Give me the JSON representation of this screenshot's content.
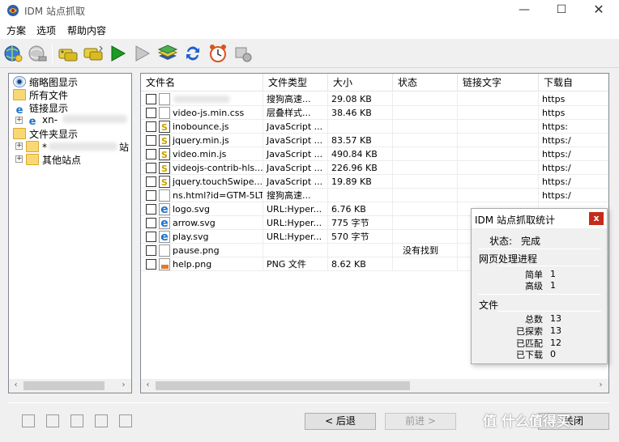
{
  "window": {
    "title": "IDM 站点抓取",
    "min_glyph": "—",
    "max_glyph": "☐",
    "close_glyph": "✕"
  },
  "menu": [
    "方案",
    "选项",
    "帮助内容"
  ],
  "toolbar": [
    "globe-connect-icon",
    "globe-disconnect-icon",
    "download-files-icon",
    "download-all-icon",
    "start-play-icon",
    "stop-play-icon",
    "queue-stack-icon",
    "refresh-icon",
    "scheduler-clock-icon",
    "settings-icon"
  ],
  "tree": {
    "items": [
      {
        "label": "缩略图显示"
      },
      {
        "label": "所有文件"
      },
      {
        "label": "链接显示"
      },
      {
        "label": "xn-"
      },
      {
        "label": "文件夹显示"
      },
      {
        "label": "*"
      },
      {
        "label": "站"
      },
      {
        "label": "其他站点"
      }
    ],
    "expander_plus": "+"
  },
  "list": {
    "columns": [
      "文件名",
      "文件类型",
      "大小",
      "状态",
      "链接文字",
      "下载自"
    ],
    "rows": [
      {
        "name": "",
        "type": "搜狗高速...",
        "size": "29.08 KB",
        "status": "",
        "link": "",
        "from": "https",
        "icon": "doc"
      },
      {
        "name": "video-js.min.css",
        "type": "层叠样式...",
        "size": "38.46 KB",
        "status": "",
        "link": "",
        "from": "https",
        "icon": "css"
      },
      {
        "name": "inobounce.js",
        "type": "JavaScript ...",
        "size": "",
        "status": "",
        "link": "",
        "from": "https:",
        "icon": "js"
      },
      {
        "name": "jquery.min.js",
        "type": "JavaScript ...",
        "size": "83.57 KB",
        "status": "",
        "link": "",
        "from": "https:/",
        "icon": "js"
      },
      {
        "name": "video.min.js",
        "type": "JavaScript ...",
        "size": "490.84 KB",
        "status": "",
        "link": "",
        "from": "https:/",
        "icon": "js"
      },
      {
        "name": "videojs-contrib-hls....",
        "type": "JavaScript ...",
        "size": "226.96 KB",
        "status": "",
        "link": "",
        "from": "https:/",
        "icon": "js"
      },
      {
        "name": "jquery.touchSwipe....",
        "type": "JavaScript ...",
        "size": "19.89 KB",
        "status": "",
        "link": "",
        "from": "https:/",
        "icon": "js"
      },
      {
        "name": "ns.html?id=GTM-5LT...",
        "type": "搜狗高速...",
        "size": "",
        "status": "",
        "link": "",
        "from": "https:/",
        "icon": "doc"
      },
      {
        "name": "logo.svg",
        "type": "URL:Hyper...",
        "size": "6.76 KB",
        "status": "",
        "link": "",
        "from": "",
        "icon": "ie"
      },
      {
        "name": "arrow.svg",
        "type": "URL:Hyper...",
        "size": "775 字节",
        "status": "",
        "link": "",
        "from": "",
        "icon": "ie"
      },
      {
        "name": "play.svg",
        "type": "URL:Hyper...",
        "size": "570 字节",
        "status": "",
        "link": "",
        "from": "",
        "icon": "ie"
      },
      {
        "name": "pause.png",
        "type": "",
        "size": "",
        "status": "没有找到",
        "link": "",
        "from": "",
        "icon": "doc"
      },
      {
        "name": "help.png",
        "type": "PNG 文件",
        "size": "8.62 KB",
        "status": "",
        "link": "",
        "from": "",
        "icon": "png"
      }
    ]
  },
  "scroll_glyphs": {
    "left": "‹",
    "right": "›"
  },
  "stats": {
    "title": "IDM 站点抓取统计",
    "close": "x",
    "status_label": "状态:",
    "status_value": "完成",
    "web_section": "网页处理进程",
    "simple_label": "简单",
    "simple_value": "1",
    "advanced_label": "高级",
    "advanced_value": "1",
    "file_section": "文件",
    "total_label": "总数",
    "total_value": "13",
    "explored_label": "已探索",
    "explored_value": "13",
    "matched_label": "已匹配",
    "matched_value": "12",
    "downloaded_label": "已下载",
    "downloaded_value": "0"
  },
  "buttons": {
    "back": "< 后退",
    "next": "前进 >",
    "cancel": "关闭"
  },
  "watermark": "值 什么值得买"
}
